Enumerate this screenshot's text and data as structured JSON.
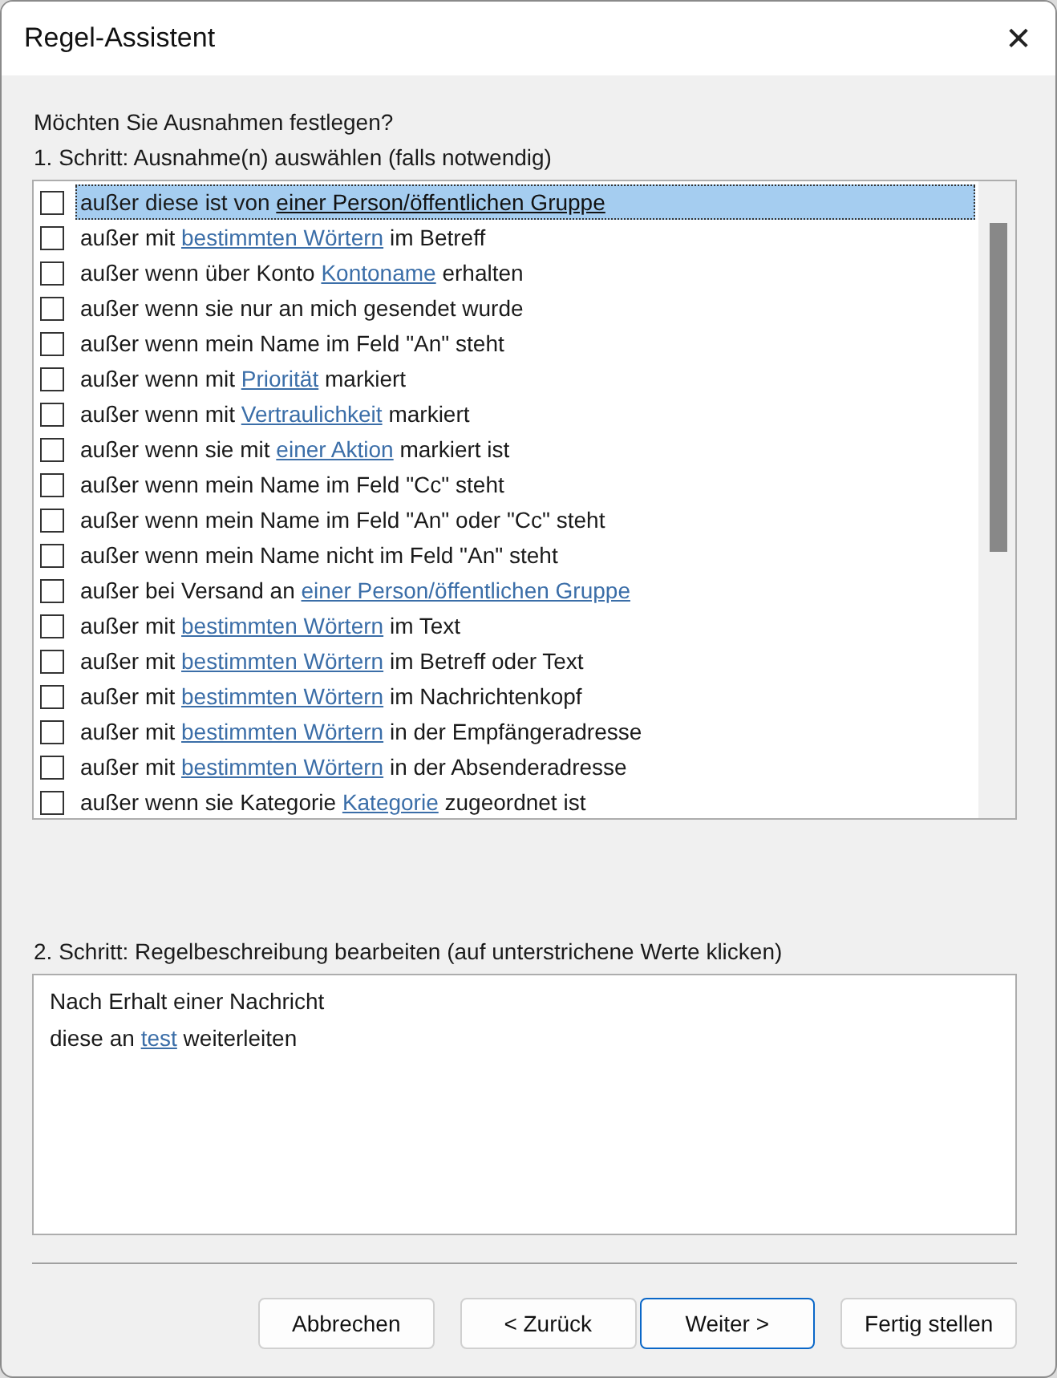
{
  "window": {
    "title": "Regel-Assistent",
    "close": "✕"
  },
  "question": "Möchten Sie Ausnahmen festlegen?",
  "step1": {
    "label": "1. Schritt: Ausnahme(n) auswählen (falls notwendig)",
    "rows": [
      {
        "checked": false,
        "selected": true,
        "parts": [
          {
            "kind": "text",
            "text": "außer diese ist von "
          },
          {
            "kind": "link",
            "text": "einer Person/öffentlichen Gruppe"
          }
        ]
      },
      {
        "checked": false,
        "selected": false,
        "parts": [
          {
            "kind": "text",
            "text": "außer mit "
          },
          {
            "kind": "link",
            "text": "bestimmten Wörtern"
          },
          {
            "kind": "text",
            "text": " im Betreff"
          }
        ]
      },
      {
        "checked": false,
        "selected": false,
        "parts": [
          {
            "kind": "text",
            "text": "außer wenn über Konto "
          },
          {
            "kind": "link",
            "text": "Kontoname"
          },
          {
            "kind": "text",
            "text": " erhalten"
          }
        ]
      },
      {
        "checked": false,
        "selected": false,
        "parts": [
          {
            "kind": "text",
            "text": "außer wenn sie nur an mich gesendet wurde"
          }
        ]
      },
      {
        "checked": false,
        "selected": false,
        "parts": [
          {
            "kind": "text",
            "text": "außer wenn mein Name im Feld \"An\" steht"
          }
        ]
      },
      {
        "checked": false,
        "selected": false,
        "parts": [
          {
            "kind": "text",
            "text": "außer wenn mit "
          },
          {
            "kind": "link",
            "text": "Priorität"
          },
          {
            "kind": "text",
            "text": " markiert"
          }
        ]
      },
      {
        "checked": false,
        "selected": false,
        "parts": [
          {
            "kind": "text",
            "text": "außer wenn mit "
          },
          {
            "kind": "link",
            "text": "Vertraulichkeit"
          },
          {
            "kind": "text",
            "text": " markiert"
          }
        ]
      },
      {
        "checked": false,
        "selected": false,
        "parts": [
          {
            "kind": "text",
            "text": "außer wenn sie mit "
          },
          {
            "kind": "link",
            "text": "einer Aktion"
          },
          {
            "kind": "text",
            "text": " markiert ist"
          }
        ]
      },
      {
        "checked": false,
        "selected": false,
        "parts": [
          {
            "kind": "text",
            "text": "außer wenn mein Name im Feld \"Cc\" steht"
          }
        ]
      },
      {
        "checked": false,
        "selected": false,
        "parts": [
          {
            "kind": "text",
            "text": "außer wenn mein Name im Feld \"An\" oder \"Cc\" steht"
          }
        ]
      },
      {
        "checked": false,
        "selected": false,
        "parts": [
          {
            "kind": "text",
            "text": "außer wenn mein Name nicht im Feld \"An\" steht"
          }
        ]
      },
      {
        "checked": false,
        "selected": false,
        "parts": [
          {
            "kind": "text",
            "text": "außer bei Versand an "
          },
          {
            "kind": "link",
            "text": "einer Person/öffentlichen Gruppe"
          }
        ]
      },
      {
        "checked": false,
        "selected": false,
        "parts": [
          {
            "kind": "text",
            "text": "außer mit "
          },
          {
            "kind": "link",
            "text": "bestimmten Wörtern"
          },
          {
            "kind": "text",
            "text": " im Text"
          }
        ]
      },
      {
        "checked": false,
        "selected": false,
        "parts": [
          {
            "kind": "text",
            "text": "außer mit "
          },
          {
            "kind": "link",
            "text": "bestimmten Wörtern"
          },
          {
            "kind": "text",
            "text": " im Betreff oder Text"
          }
        ]
      },
      {
        "checked": false,
        "selected": false,
        "parts": [
          {
            "kind": "text",
            "text": "außer mit "
          },
          {
            "kind": "link",
            "text": "bestimmten Wörtern"
          },
          {
            "kind": "text",
            "text": " im Nachrichtenkopf"
          }
        ]
      },
      {
        "checked": false,
        "selected": false,
        "parts": [
          {
            "kind": "text",
            "text": "außer mit "
          },
          {
            "kind": "link",
            "text": "bestimmten Wörtern"
          },
          {
            "kind": "text",
            "text": " in der Empfängeradresse"
          }
        ]
      },
      {
        "checked": false,
        "selected": false,
        "parts": [
          {
            "kind": "text",
            "text": "außer mit "
          },
          {
            "kind": "link",
            "text": "bestimmten Wörtern"
          },
          {
            "kind": "text",
            "text": " in der Absenderadresse"
          }
        ]
      },
      {
        "checked": false,
        "selected": false,
        "parts": [
          {
            "kind": "text",
            "text": "außer wenn sie Kategorie "
          },
          {
            "kind": "link",
            "text": "Kategorie"
          },
          {
            "kind": "text",
            "text": " zugeordnet ist"
          }
        ]
      }
    ]
  },
  "step2": {
    "label": "2. Schritt: Regelbeschreibung bearbeiten (auf unterstrichene Werte klicken)",
    "lines": [
      [
        {
          "kind": "text",
          "text": "Nach Erhalt einer Nachricht"
        }
      ],
      [
        {
          "kind": "text",
          "text": "diese an "
        },
        {
          "kind": "link",
          "text": "test"
        },
        {
          "kind": "text",
          "text": " weiterleiten"
        }
      ]
    ]
  },
  "buttons": [
    {
      "label": "Abbrechen",
      "default": false
    },
    {
      "label": "< Zurück",
      "default": false
    },
    {
      "label": "Weiter >",
      "default": true
    },
    {
      "label": "Fertig stellen",
      "default": false
    }
  ]
}
